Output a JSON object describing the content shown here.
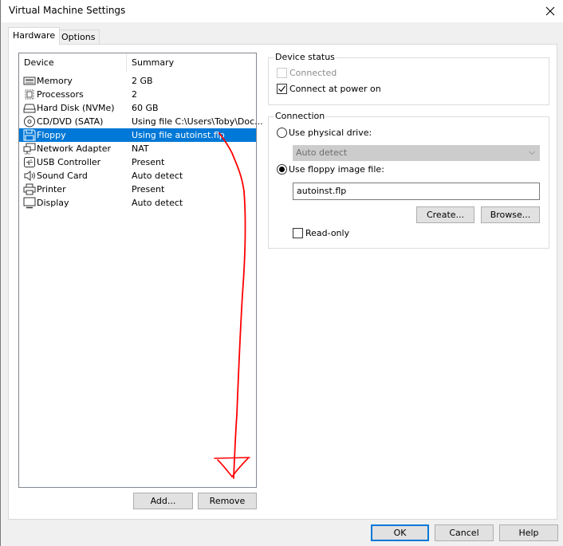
{
  "window": {
    "title": "Virtual Machine Settings",
    "close_icon": "close-icon"
  },
  "tabs": [
    {
      "label": "Hardware",
      "active": true
    },
    {
      "label": "Options",
      "active": false
    }
  ],
  "device_list": {
    "columns": [
      "Device",
      "Summary"
    ],
    "rows": [
      {
        "icon": "memory-icon",
        "device": "Memory",
        "summary": "2 GB",
        "selected": false
      },
      {
        "icon": "processor-icon",
        "device": "Processors",
        "summary": "2",
        "selected": false
      },
      {
        "icon": "hard-disk-icon",
        "device": "Hard Disk (NVMe)",
        "summary": "60 GB",
        "selected": false
      },
      {
        "icon": "cd-dvd-icon",
        "device": "CD/DVD (SATA)",
        "summary": "Using file C:\\Users\\Toby\\Doc...",
        "selected": false
      },
      {
        "icon": "floppy-icon",
        "device": "Floppy",
        "summary": "Using file autoinst.flp",
        "selected": true
      },
      {
        "icon": "network-adapter-icon",
        "device": "Network Adapter",
        "summary": "NAT",
        "selected": false
      },
      {
        "icon": "usb-icon",
        "device": "USB Controller",
        "summary": "Present",
        "selected": false
      },
      {
        "icon": "sound-card-icon",
        "device": "Sound Card",
        "summary": "Auto detect",
        "selected": false
      },
      {
        "icon": "printer-icon",
        "device": "Printer",
        "summary": "Present",
        "selected": false
      },
      {
        "icon": "display-icon",
        "device": "Display",
        "summary": "Auto detect",
        "selected": false
      }
    ],
    "add_label": "Add...",
    "remove_label": "Remove"
  },
  "device_status": {
    "legend": "Device status",
    "connected_label": "Connected",
    "connected_checked": false,
    "connected_enabled": false,
    "power_on_label": "Connect at power on",
    "power_on_checked": true
  },
  "connection": {
    "legend": "Connection",
    "physical_label": "Use physical drive:",
    "physical_selected": false,
    "physical_drive_value": "Auto detect",
    "image_label": "Use floppy image file:",
    "image_selected": true,
    "image_file_value": "autoinst.flp",
    "create_label": "Create...",
    "browse_label": "Browse...",
    "readonly_label": "Read-only",
    "readonly_checked": false
  },
  "footer": {
    "ok_label": "OK",
    "cancel_label": "Cancel",
    "help_label": "Help"
  },
  "annotation": {
    "type": "hand-drawn arrow",
    "color": "#ff0000"
  }
}
